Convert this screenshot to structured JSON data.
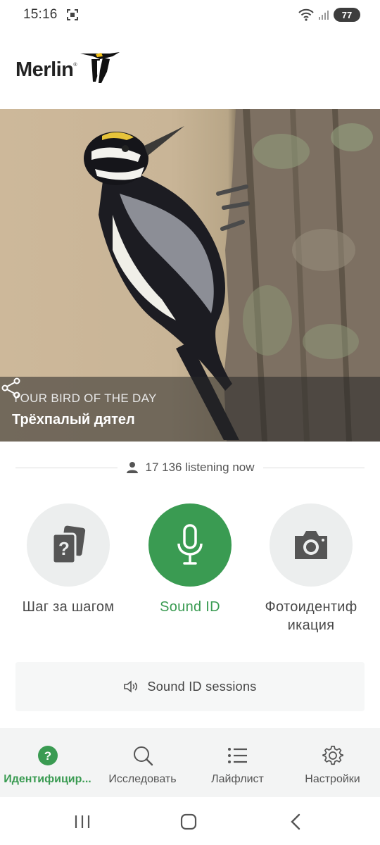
{
  "status_bar": {
    "time": "15:16",
    "battery": "77",
    "icons": [
      "screenshot-icon",
      "wifi-icon",
      "signal-icon",
      "battery-icon"
    ]
  },
  "app": {
    "logo_text": "Merlin",
    "logo_reg": "®"
  },
  "hero": {
    "kicker": "YOUR BIRD OF THE DAY",
    "bird_name": "Трёхпалый дятел",
    "share_icon": "share-icon"
  },
  "listening": {
    "icon": "person-icon",
    "text": "17 136 listening now"
  },
  "actions": [
    {
      "label": "Шаг за шагом",
      "icon": "question-cards-icon"
    },
    {
      "label": "Sound ID",
      "icon": "microphone-icon"
    },
    {
      "label": "Фотоидентиф икация",
      "icon": "camera-icon"
    }
  ],
  "sessions": {
    "icon": "speaker-icon",
    "label": "Sound ID sessions"
  },
  "bottom_nav": [
    {
      "label": "Идентифицир...",
      "icon": "help-circle-icon",
      "active": true
    },
    {
      "label": "Исследовать",
      "icon": "search-icon",
      "active": false
    },
    {
      "label": "Лайфлист",
      "icon": "list-icon",
      "active": false
    },
    {
      "label": "Настройки",
      "icon": "gear-icon",
      "active": false
    }
  ],
  "colors": {
    "accent_green": "#3a9b52",
    "circle_bg": "#eceeee",
    "nav_bg": "#f3f4f4"
  }
}
